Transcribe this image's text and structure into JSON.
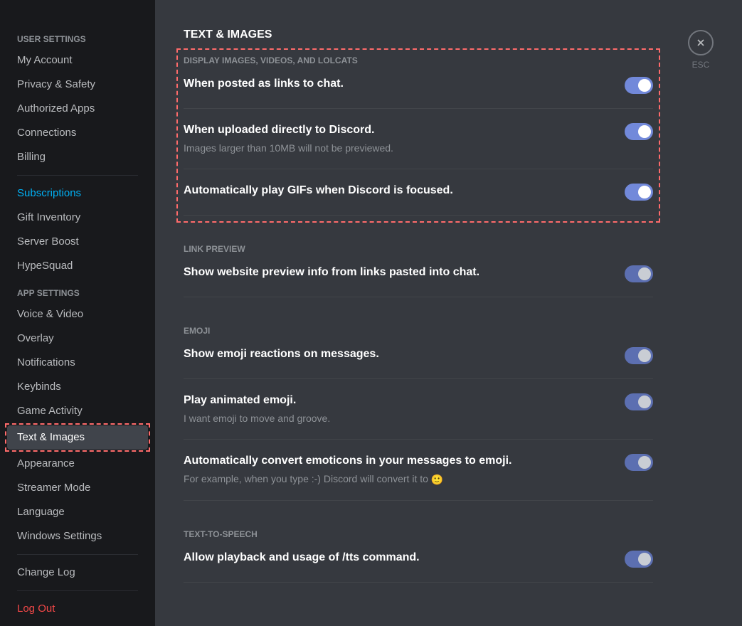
{
  "sidebar": {
    "user_settings_header": "USER SETTINGS",
    "app_settings_header": "APP SETTINGS",
    "items_user": [
      {
        "label": "My Account"
      },
      {
        "label": "Privacy & Safety"
      },
      {
        "label": "Authorized Apps"
      },
      {
        "label": "Connections"
      },
      {
        "label": "Billing"
      }
    ],
    "items_billing": [
      {
        "label": "Subscriptions",
        "link": true
      },
      {
        "label": "Gift Inventory"
      },
      {
        "label": "Server Boost"
      },
      {
        "label": "HypeSquad"
      }
    ],
    "items_app": [
      {
        "label": "Voice & Video"
      },
      {
        "label": "Overlay"
      },
      {
        "label": "Notifications"
      },
      {
        "label": "Keybinds"
      },
      {
        "label": "Game Activity"
      },
      {
        "label": "Text & Images",
        "active": true,
        "highlighted": true
      },
      {
        "label": "Appearance"
      },
      {
        "label": "Streamer Mode"
      },
      {
        "label": "Language"
      },
      {
        "label": "Windows Settings"
      }
    ],
    "change_log": "Change Log",
    "log_out": "Log Out"
  },
  "main": {
    "title": "TEXT & IMAGES",
    "close_label": "ESC",
    "groups": [
      {
        "header": "DISPLAY IMAGES, VIDEOS, AND LOLCATS",
        "highlighted": true,
        "settings": [
          {
            "label": "When posted as links to chat.",
            "on": true,
            "bright": true
          },
          {
            "label": "When uploaded directly to Discord.",
            "desc": "Images larger than 10MB will not be previewed.",
            "on": true,
            "bright": true
          },
          {
            "label": "Automatically play GIFs when Discord is focused.",
            "on": true,
            "bright": true
          }
        ]
      },
      {
        "header": "LINK PREVIEW",
        "settings": [
          {
            "label": "Show website preview info from links pasted into chat.",
            "on": true
          }
        ]
      },
      {
        "header": "EMOJI",
        "settings": [
          {
            "label": "Show emoji reactions on messages.",
            "on": true
          },
          {
            "label": "Play animated emoji.",
            "desc": "I want emoji to move and groove.",
            "on": true
          },
          {
            "label": "Automatically convert emoticons in your messages to emoji.",
            "desc": "For example, when you type :-) Discord will convert it to ",
            "emoji": "🙂",
            "on": true
          }
        ]
      },
      {
        "header": "TEXT-TO-SPEECH",
        "settings": [
          {
            "label": "Allow playback and usage of /tts command.",
            "on": true
          }
        ]
      }
    ]
  }
}
